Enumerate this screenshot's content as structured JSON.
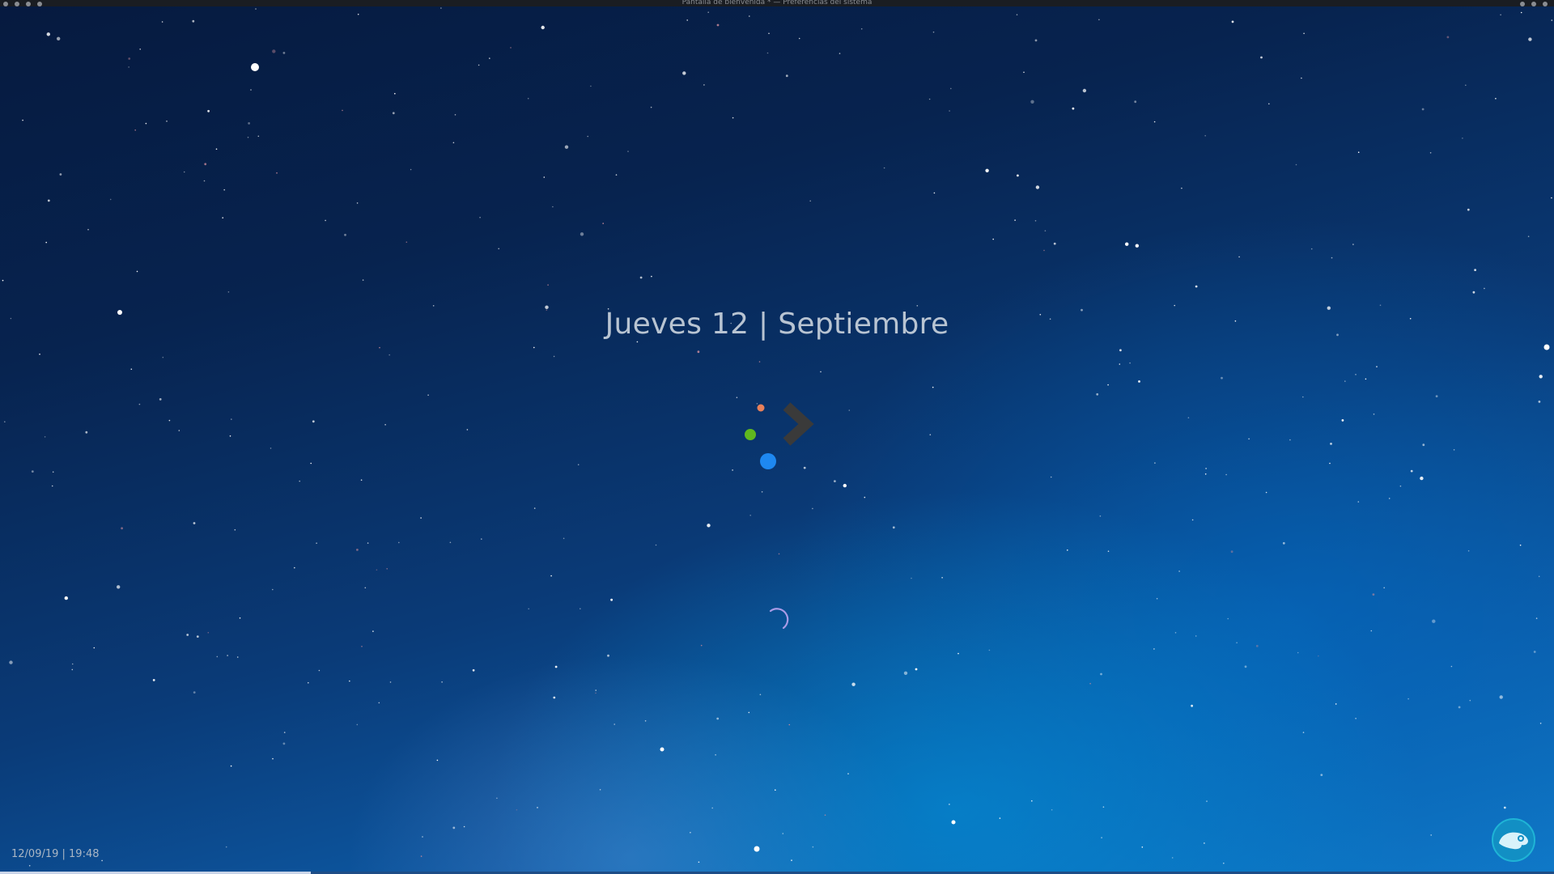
{
  "window": {
    "title": "Pantalla de bienvenida * — Preferencias del sistema"
  },
  "splash": {
    "date_text": "Jueves 12 | Septiembre",
    "clock_text": "12/09/19 | 19:48",
    "progress_fraction": 0.2
  },
  "icons": {
    "logo": "opensuse-chameleon-icon",
    "loader": "plasma-loader-icon",
    "spinner": "busy-spinner-icon"
  },
  "colors": {
    "loader_orange": "#e8805a",
    "loader_green": "#5fb81f",
    "loader_blue": "#1e88f0",
    "loader_chevron": "#3a3a3a",
    "spinner": "#a99be6",
    "logo_ring": "#1fb4d6",
    "text": "#b8c4d2"
  }
}
